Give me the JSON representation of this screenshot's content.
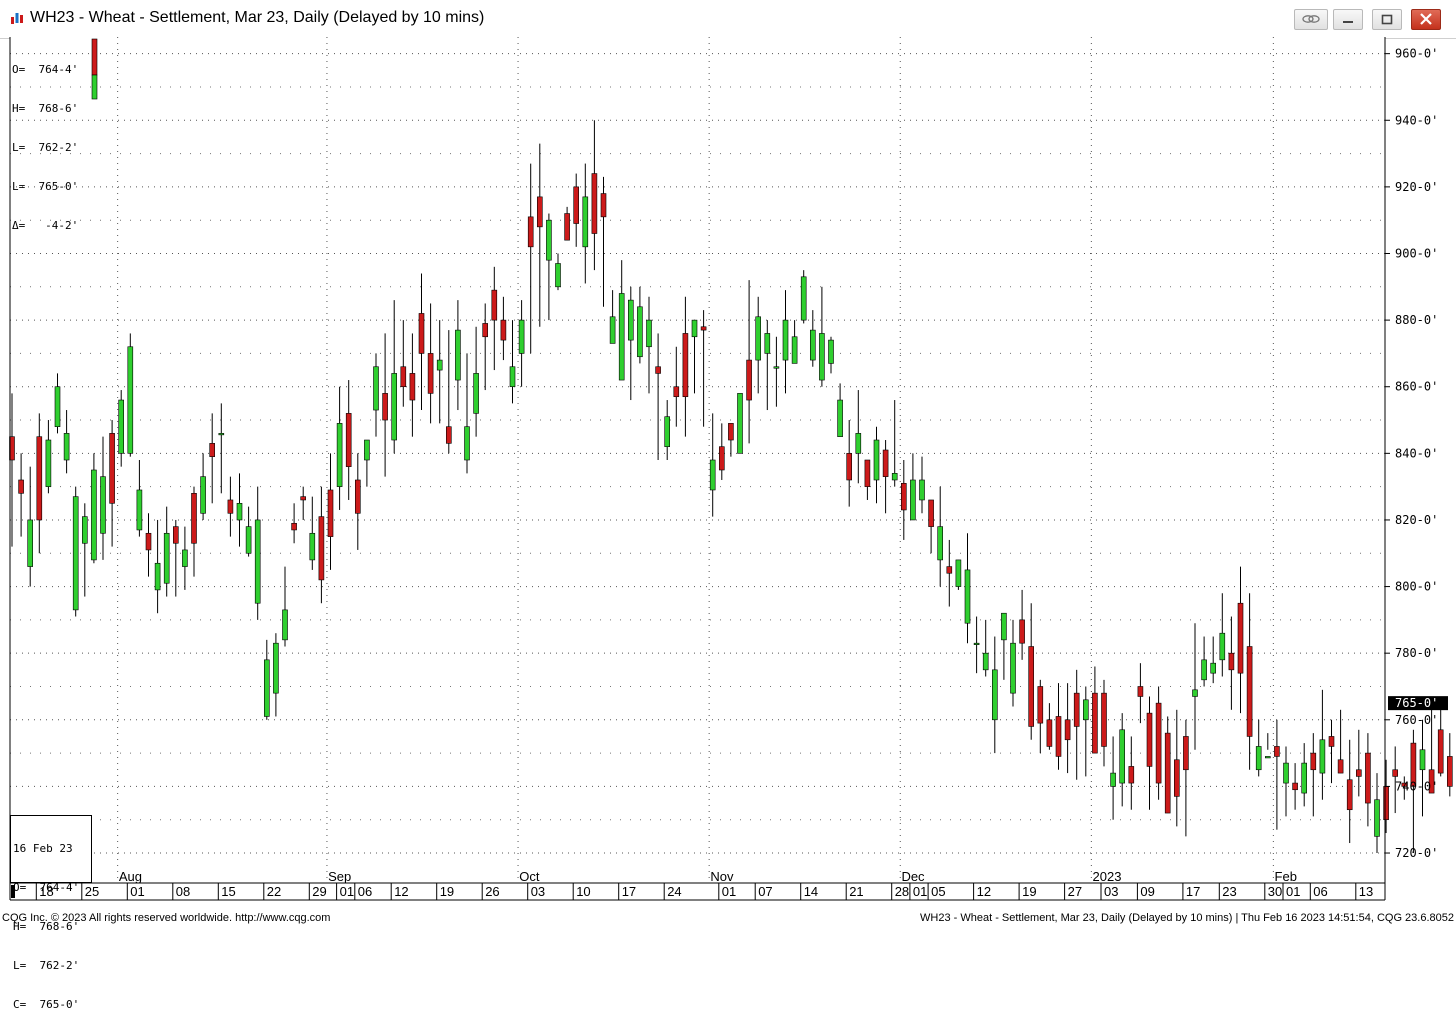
{
  "window": {
    "title": "WH23 - Wheat - Settlement, Mar 23, Daily (Delayed by 10 mins)"
  },
  "top_ohlc": {
    "o": "O=  764-4'",
    "h": "H=  768-6'",
    "l": "L=  762-2'",
    "c": "L=  765-0'",
    "d": "Δ=   -4-2'"
  },
  "bottom_ohlc": {
    "date": "16 Feb 23",
    "o": "O=  764-4'",
    "h": "H=  768-6'",
    "l": "L=  762-2'",
    "c": "C=  765-0'"
  },
  "footer": {
    "left": "CQG Inc. © 2023 All rights reserved worldwide. http://www.cqg.com",
    "right": "WH23 - Wheat - Settlement, Mar 23, Daily (Delayed by 10 mins) | Thu Feb 16 2023 14:51:54, CQG 23.6.8052"
  },
  "colors": {
    "up": "#2fcf2f",
    "down": "#cc1a1a",
    "last_price_bg": "#000000",
    "last_price_fg": "#ffffff"
  },
  "chart_data": {
    "type": "candlestick",
    "ylim": [
      711,
      965
    ],
    "y_ticks": [
      {
        "v": 960,
        "label": "960-0'"
      },
      {
        "v": 940,
        "label": "940-0'"
      },
      {
        "v": 920,
        "label": "920-0'"
      },
      {
        "v": 900,
        "label": "900-0'"
      },
      {
        "v": 880,
        "label": "880-0'"
      },
      {
        "v": 860,
        "label": "860-0'"
      },
      {
        "v": 840,
        "label": "840-0'"
      },
      {
        "v": 820,
        "label": "820-0'"
      },
      {
        "v": 800,
        "label": "800-0'"
      },
      {
        "v": 780,
        "label": "780-0'"
      },
      {
        "v": 760,
        "label": "760-0'"
      },
      {
        "v": 740,
        "label": "740-0'"
      },
      {
        "v": 720,
        "label": "720-0'"
      }
    ],
    "last_price": {
      "v": 765,
      "label": "765-0'"
    },
    "x_ticks": [
      {
        "i": 3,
        "label": "18"
      },
      {
        "i": 8,
        "label": "25"
      },
      {
        "i": 13,
        "label": "01"
      },
      {
        "i": 18,
        "label": "08"
      },
      {
        "i": 23,
        "label": "15"
      },
      {
        "i": 28,
        "label": "22"
      },
      {
        "i": 33,
        "label": "29"
      },
      {
        "i": 36,
        "label": "01"
      },
      {
        "i": 38,
        "label": "06"
      },
      {
        "i": 42,
        "label": "12"
      },
      {
        "i": 47,
        "label": "19"
      },
      {
        "i": 52,
        "label": "26"
      },
      {
        "i": 57,
        "label": "03"
      },
      {
        "i": 62,
        "label": "10"
      },
      {
        "i": 67,
        "label": "17"
      },
      {
        "i": 72,
        "label": "24"
      },
      {
        "i": 78,
        "label": "01"
      },
      {
        "i": 82,
        "label": "07"
      },
      {
        "i": 87,
        "label": "14"
      },
      {
        "i": 92,
        "label": "21"
      },
      {
        "i": 97,
        "label": "28"
      },
      {
        "i": 99,
        "label": "01"
      },
      {
        "i": 101,
        "label": "05"
      },
      {
        "i": 106,
        "label": "12"
      },
      {
        "i": 111,
        "label": "19"
      },
      {
        "i": 116,
        "label": "27"
      },
      {
        "i": 120,
        "label": "03"
      },
      {
        "i": 124,
        "label": "09"
      },
      {
        "i": 129,
        "label": "17"
      },
      {
        "i": 133,
        "label": "23"
      },
      {
        "i": 138,
        "label": "30"
      },
      {
        "i": 140,
        "label": "01"
      },
      {
        "i": 143,
        "label": "06"
      },
      {
        "i": 148,
        "label": "13"
      }
    ],
    "month_labels": [
      {
        "i": 12.4,
        "label": "Aug"
      },
      {
        "i": 35.4,
        "label": "Sep"
      },
      {
        "i": 56.4,
        "label": "Oct"
      },
      {
        "i": 77.4,
        "label": "Nov"
      },
      {
        "i": 98.4,
        "label": "Dec"
      },
      {
        "i": 119.4,
        "label": "2023"
      },
      {
        "i": 139.4,
        "label": "Feb"
      }
    ],
    "month_separators": [
      12,
      35,
      56,
      77,
      98,
      119,
      139
    ],
    "candles": [
      [
        845,
        838,
        812,
        858
      ],
      [
        832,
        828,
        815,
        840
      ],
      [
        806,
        820,
        800,
        836
      ],
      [
        845,
        820,
        810,
        852
      ],
      [
        830,
        844,
        828,
        850
      ],
      [
        848,
        860,
        846,
        864
      ],
      [
        838,
        846,
        834,
        853
      ],
      [
        793,
        827,
        791,
        830
      ],
      [
        813,
        821,
        797,
        825
      ],
      [
        808,
        835,
        807,
        840
      ],
      [
        816,
        833,
        808,
        845
      ],
      [
        846,
        825,
        812,
        850
      ],
      [
        840,
        856,
        836,
        859
      ],
      [
        840,
        872,
        839,
        876
      ],
      [
        817,
        829,
        815,
        838
      ],
      [
        816,
        811,
        803,
        822
      ],
      [
        799,
        807,
        792,
        820
      ],
      [
        801,
        816,
        797,
        824
      ],
      [
        818,
        813,
        797,
        820
      ],
      [
        806,
        811,
        799,
        818
      ],
      [
        828,
        813,
        803,
        830
      ],
      [
        822,
        833,
        820,
        840
      ],
      [
        843,
        839,
        825,
        852
      ],
      [
        846,
        846,
        828,
        855
      ],
      [
        826,
        822,
        815,
        833
      ],
      [
        820,
        825,
        812,
        834
      ],
      [
        810,
        818,
        809,
        824
      ],
      [
        795,
        820,
        790,
        830
      ],
      [
        761,
        778,
        760,
        784
      ],
      [
        768,
        783,
        761,
        786
      ],
      [
        784,
        793,
        782,
        806
      ],
      [
        819,
        817,
        813,
        825
      ],
      [
        827,
        826,
        820,
        830
      ],
      [
        808,
        816,
        805,
        827
      ],
      [
        821,
        802,
        795,
        830
      ],
      [
        829,
        815,
        805,
        840
      ],
      [
        830,
        849,
        823,
        860
      ],
      [
        852,
        836,
        826,
        862
      ],
      [
        832,
        822,
        811,
        840
      ],
      [
        838,
        844,
        830,
        844
      ],
      [
        853,
        866,
        845,
        870
      ],
      [
        858,
        850,
        833,
        876
      ],
      [
        844,
        864,
        840,
        886
      ],
      [
        866,
        860,
        854,
        880
      ],
      [
        864,
        856,
        845,
        876
      ],
      [
        882,
        870,
        853,
        894
      ],
      [
        870,
        858,
        849,
        885
      ],
      [
        865,
        868,
        849,
        880
      ],
      [
        848,
        843,
        840,
        877
      ],
      [
        862,
        877,
        853,
        886
      ],
      [
        838,
        848,
        834,
        870
      ],
      [
        852,
        864,
        845,
        878
      ],
      [
        879,
        875,
        859,
        885
      ],
      [
        889,
        880,
        865,
        896
      ],
      [
        880,
        874,
        868,
        887
      ],
      [
        860,
        866,
        855,
        880
      ],
      [
        870,
        880,
        860,
        886
      ],
      [
        911,
        902,
        870,
        927
      ],
      [
        917,
        908,
        878,
        933
      ],
      [
        898,
        910,
        880,
        912
      ],
      [
        890,
        897,
        889,
        900
      ],
      [
        912,
        904,
        904,
        914
      ],
      [
        920,
        909,
        902,
        924
      ],
      [
        902,
        917,
        891,
        927
      ],
      [
        924,
        906,
        895,
        940
      ],
      [
        918,
        911,
        884,
        923
      ],
      [
        873,
        881,
        880,
        889
      ],
      [
        862,
        888,
        876,
        898
      ],
      [
        874,
        886,
        856,
        890
      ],
      [
        869,
        884,
        867,
        890
      ],
      [
        872,
        880,
        858,
        887
      ],
      [
        866,
        864,
        838,
        876
      ],
      [
        842,
        851,
        838,
        856
      ],
      [
        860,
        857,
        848,
        872
      ],
      [
        876,
        857,
        845,
        887
      ],
      [
        875,
        880,
        858,
        880
      ],
      [
        878,
        877,
        848,
        883
      ],
      [
        829,
        838,
        821,
        852
      ],
      [
        842,
        835,
        832,
        849
      ],
      [
        849,
        844,
        839,
        849
      ],
      [
        840,
        858,
        846,
        856
      ],
      [
        868,
        856,
        843,
        892
      ],
      [
        868,
        881,
        858,
        887
      ],
      [
        870,
        876,
        853,
        880
      ],
      [
        866,
        866,
        854,
        875
      ],
      [
        868,
        880,
        858,
        889
      ],
      [
        867,
        875,
        870,
        880
      ],
      [
        880,
        893,
        879,
        895
      ],
      [
        868,
        877,
        866,
        883
      ],
      [
        862,
        876,
        860,
        890
      ],
      [
        867,
        874,
        864,
        875
      ],
      [
        845,
        856,
        846,
        861
      ],
      [
        840,
        832,
        824,
        850
      ],
      [
        840,
        846,
        831,
        859
      ],
      [
        838,
        830,
        826,
        838
      ],
      [
        832,
        844,
        825,
        848
      ],
      [
        841,
        833,
        822,
        844
      ],
      [
        832,
        834,
        830,
        856
      ],
      [
        831,
        823,
        814,
        838
      ],
      [
        820,
        832,
        820,
        840
      ],
      [
        826,
        832,
        822,
        839
      ],
      [
        826,
        818,
        810,
        826
      ],
      [
        808,
        818,
        800,
        830
      ],
      [
        806,
        804,
        794,
        814
      ],
      [
        800,
        808,
        799,
        808
      ],
      [
        789,
        805,
        783,
        816
      ],
      [
        783,
        783,
        774,
        791
      ],
      [
        775,
        780,
        773,
        790
      ],
      [
        760,
        775,
        750,
        785
      ],
      [
        784,
        792,
        772,
        790
      ],
      [
        768,
        783,
        764,
        790
      ],
      [
        790,
        783,
        778,
        799
      ],
      [
        782,
        758,
        754,
        795
      ],
      [
        770,
        759,
        750,
        772
      ],
      [
        760,
        752,
        751,
        765
      ],
      [
        761,
        749,
        745,
        771
      ],
      [
        760,
        754,
        744,
        771
      ],
      [
        768,
        758,
        742,
        775
      ],
      [
        760,
        766,
        743,
        770
      ],
      [
        768,
        750,
        750,
        776
      ],
      [
        768,
        752,
        746,
        772
      ],
      [
        740,
        744,
        730,
        755
      ],
      [
        741,
        757,
        734,
        762
      ],
      [
        746,
        741,
        733,
        755
      ],
      [
        770,
        767,
        759,
        777
      ],
      [
        762,
        746,
        733,
        767
      ],
      [
        765,
        741,
        736,
        770
      ],
      [
        756,
        732,
        732,
        761
      ],
      [
        748,
        737,
        728,
        763
      ],
      [
        755,
        745,
        725,
        760
      ],
      [
        767,
        769,
        751,
        789
      ],
      [
        772,
        778,
        770,
        785
      ],
      [
        774,
        777,
        771,
        785
      ],
      [
        778,
        786,
        773,
        798
      ],
      [
        780,
        775,
        763,
        791
      ],
      [
        795,
        774,
        762,
        806
      ],
      [
        782,
        755,
        745,
        798
      ],
      [
        745,
        752,
        743,
        760
      ],
      [
        749,
        749,
        751,
        756
      ],
      [
        752,
        749,
        727,
        760
      ],
      [
        741,
        747,
        731,
        752
      ],
      [
        741,
        739,
        733,
        747
      ],
      [
        738,
        747,
        734,
        753
      ],
      [
        750,
        745,
        731,
        756
      ],
      [
        744,
        754,
        736,
        769
      ],
      [
        755,
        752,
        741,
        760
      ],
      [
        748,
        744,
        744,
        763
      ],
      [
        742,
        733,
        723,
        754
      ],
      [
        745,
        743,
        737,
        757
      ],
      [
        750,
        735,
        728,
        756
      ],
      [
        725,
        736,
        720,
        744
      ],
      [
        740,
        730,
        726,
        748
      ],
      [
        745,
        743,
        732,
        752
      ],
      [
        741,
        740,
        736,
        743
      ],
      [
        753,
        740,
        720,
        757
      ],
      [
        745,
        751,
        731,
        760
      ],
      [
        745,
        738,
        743,
        763
      ],
      [
        757,
        744,
        743,
        763
      ],
      [
        749,
        740,
        737,
        756
      ],
      [
        755,
        760,
        739,
        766
      ],
      [
        743,
        755,
        736,
        762
      ],
      [
        763,
        751,
        733,
        764
      ],
      [
        757,
        751,
        740,
        759
      ],
      [
        760,
        760,
        745,
        778
      ],
      [
        769,
        764,
        751,
        779
      ],
      [
        754,
        758,
        755,
        770
      ],
      [
        756,
        772,
        753,
        778
      ],
      [
        749,
        749,
        745,
        776
      ],
      [
        769,
        748,
        744,
        773
      ],
      [
        762,
        755,
        752,
        772
      ],
      [
        773,
        766,
        751,
        778
      ],
      [
        781,
        785,
        762,
        793
      ],
      [
        770,
        791,
        775,
        797
      ],
      [
        785,
        787,
        785,
        797
      ],
      [
        792,
        795,
        781,
        798
      ],
      [
        776,
        761,
        771,
        784
      ],
      [
        768,
        765,
        762,
        769
      ]
    ]
  }
}
